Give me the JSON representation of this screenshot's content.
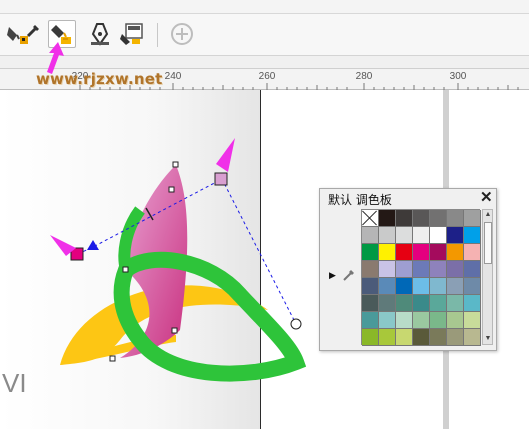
{
  "toolbar": {
    "tools": [
      {
        "name": "fill-tool",
        "icon": "fill-icon"
      },
      {
        "name": "eyedropper-tool",
        "icon": "eyedropper-icon"
      },
      {
        "name": "smart-fill-tool",
        "icon": "paint-bucket-icon",
        "active": true
      },
      {
        "name": "outline-pen-tool",
        "icon": "pen-nib-icon"
      },
      {
        "name": "interactive-fill-tool",
        "icon": "interactive-fill-icon"
      },
      {
        "name": "add-tool",
        "icon": "plus-circle-icon"
      }
    ]
  },
  "ruler": {
    "labels": [
      "220",
      "240",
      "260",
      "280",
      "300"
    ]
  },
  "canvas": {
    "watermark": "www.rjzxw.net",
    "corner_letter": "VI"
  },
  "palette": {
    "title": "默认 调色板",
    "close": "✕",
    "swatches": [
      "none",
      "#231815",
      "#3e3a39",
      "#595757",
      "#727171",
      "#898989",
      "#9fa0a0",
      "#b5b5b6",
      "#c9caca",
      "#dcdddd",
      "#efefef",
      "#ffffff",
      "#1d2088",
      "#00a0e9",
      "#009944",
      "#fff100",
      "#e60012",
      "#e4007f",
      "#a40b5d",
      "#f39800",
      "#f5b2b2",
      "#8a7a6f",
      "#c9c3e6",
      "#9e9ed1",
      "#6c7ab8",
      "#8e82bc",
      "#7b6fa8",
      "#5f6fa8",
      "#4b5b7a",
      "#5a8ab8",
      "#0068b7",
      "#6cbde8",
      "#7fb8cf",
      "#8a9fb5",
      "#6e8aa8",
      "#4a5a5a",
      "#5f7a7a",
      "#4f8a7a",
      "#3a8a8a",
      "#5aa89a",
      "#7ab8a8",
      "#5ab8c8",
      "#4a9a9a",
      "#8ac8c8",
      "#b8dcc8",
      "#9ac8a0",
      "#7ab88a",
      "#a8c890",
      "#c8dc9a",
      "#8ab828",
      "#a8c83a",
      "#c8d870",
      "#5a5a3a",
      "#7a7a5a",
      "#9a9a7a",
      "#b8b890"
    ]
  },
  "colors": {
    "handle_magenta": "#e4007f",
    "handle_pink": "#d89fd0",
    "handle_blue": "#1a1ae6",
    "callout_arrow": "#f030e8",
    "petal_yellow": "#fdc614",
    "petal_green": "#2ec43a",
    "petal_pink": "#d452a8"
  }
}
